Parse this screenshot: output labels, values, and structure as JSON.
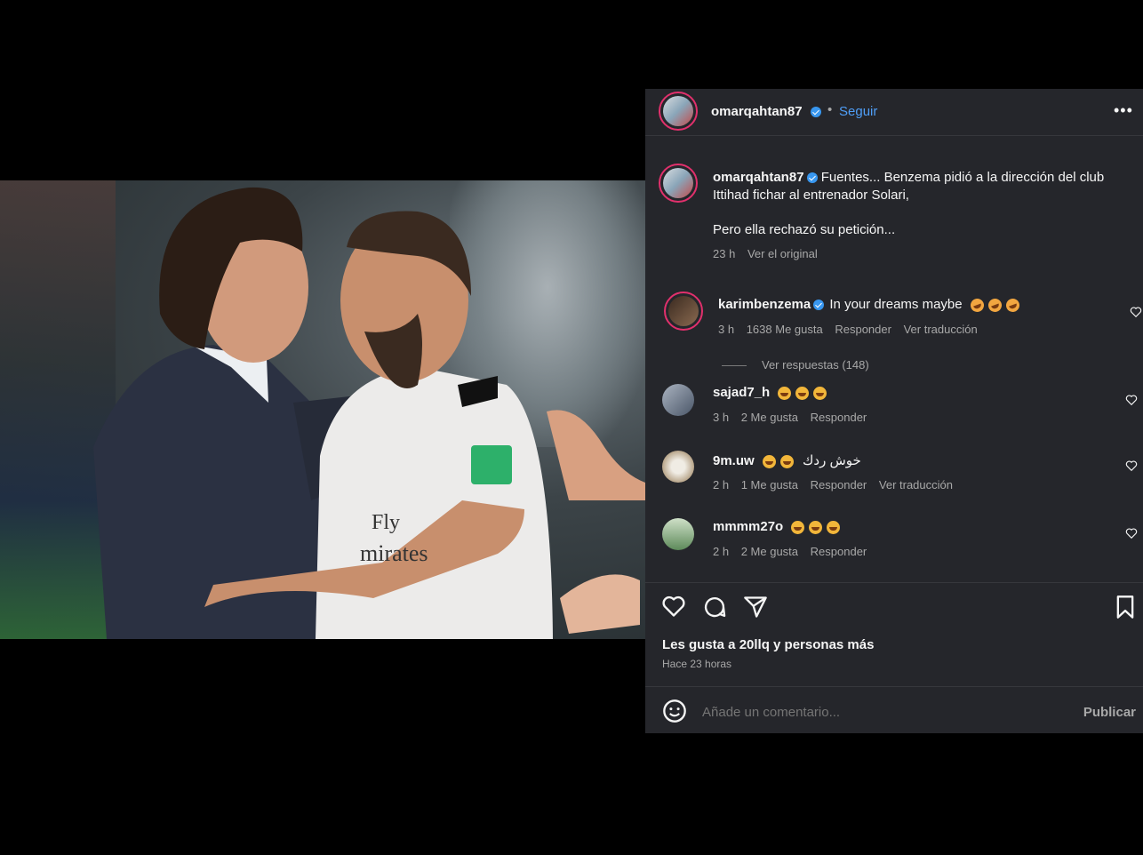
{
  "post": {
    "author": "omarqahtan87",
    "follow_label": "Seguir",
    "caption_line1": "Fuentes... Benzema pidió a la dirección del club",
    "caption_line2": "Ittihad fichar al entrenador Solari,",
    "caption_line3": "Pero ella rechazó su petición...",
    "time": "23 h",
    "see_original": "Ver el original",
    "likes_text": "Les gusta a 20llq y personas más",
    "posted_ago": "Hace 23 horas",
    "comment_placeholder": "Añade un comentario...",
    "publish_label": "Publicar"
  },
  "comments": [
    {
      "user": "karimbenzema",
      "verified": true,
      "text": "In your dreams maybe",
      "time": "3 h",
      "likes": "1638 Me gusta",
      "reply": "Responder",
      "translate": "Ver traducción",
      "view_replies": "Ver respuestas (148)"
    },
    {
      "user": "sajad7_h",
      "text": "",
      "time": "3 h",
      "likes": "2 Me gusta",
      "reply": "Responder"
    },
    {
      "user": "9m.uw",
      "text": "خوش ردك",
      "time": "2 h",
      "likes": "1 Me gusta",
      "reply": "Responder",
      "translate": "Ver traducción"
    },
    {
      "user": "mmmm27o",
      "text": "",
      "time": "2 h",
      "likes": "2 Me gusta",
      "reply": "Responder"
    }
  ],
  "photo": {
    "jersey_text_1": "Fly",
    "jersey_text_2": "mirates"
  },
  "colors": {
    "panel_bg": "#25262b",
    "link_blue": "#4f9ef7",
    "verified_blue": "#3897f0"
  },
  "icons": [
    "more-icon",
    "heart-icon",
    "comment-icon",
    "share-icon",
    "bookmark-icon",
    "emoji-icon",
    "verified-icon"
  ]
}
